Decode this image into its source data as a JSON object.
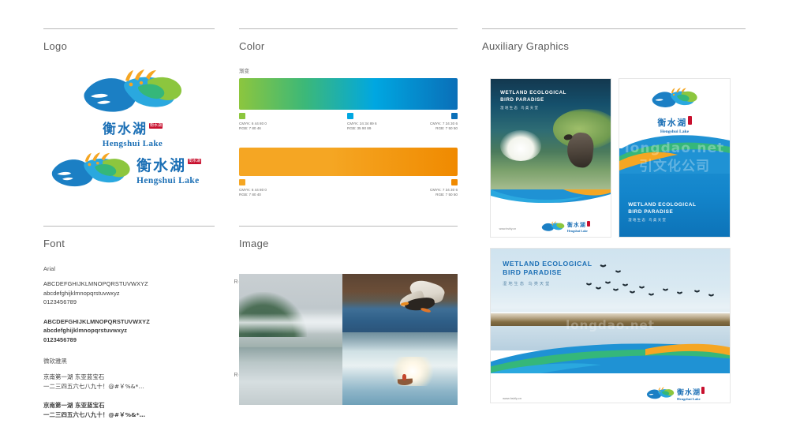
{
  "sections": {
    "logo": {
      "title": "Logo"
    },
    "color": {
      "title": "Color"
    },
    "auxiliary": {
      "title": "Auxiliary Graphics"
    },
    "font": {
      "title": "Font"
    },
    "image": {
      "title": "Image"
    }
  },
  "brand": {
    "cn_name": "衡水湖",
    "en_name": "Hengshui Lake",
    "seal": "衡水湖",
    "website": "www.hshly.cn",
    "slogan_en_line1": "WETLAND ECOLOGICAL",
    "slogan_en_line2": "BIRD PARADISE",
    "slogan_cn": "湿地生态 鸟类天堂"
  },
  "color": {
    "swatch_label": "渐变",
    "gradient_primary": {
      "stops": [
        {
          "hex": "#8CC63E",
          "cmyk": "CMYK: 6 44 80 0",
          "rgb": "RGB: 7 80 46"
        },
        {
          "hex": "#00A7E1",
          "cmyk": "CMYK: 24 34 89 6",
          "rgb": "RGB: 35 90 89"
        },
        {
          "hex": "#0A6FB8",
          "cmyk": "CMYK: 7 34 30 6",
          "rgb": "RGB: 7 50 50"
        }
      ]
    },
    "gradient_secondary": {
      "stops": [
        {
          "hex": "#F5A623",
          "cmyk": "CMYK: 6 44 80 0",
          "rgb": "RGB: 7 80 40"
        },
        {
          "hex": "#F08A00",
          "cmyk": "CMYK: 7 34 30 6",
          "rgb": "RGB: 7 50 50"
        }
      ]
    }
  },
  "fonts": [
    {
      "family": "Arial",
      "specimens": [
        {
          "weight_label": "Regular",
          "lines": [
            "ABCDEFGHIJKLMNOPQRSTUVWXYZ",
            "abcdefghijklmnopqrstuvwxyz",
            "0123456789"
          ]
        },
        {
          "weight_label": "Bold",
          "lines": [
            "ABCDEFGHIJKLMNOPQRSTUVWXYZ",
            "abcdefghijklmnopqrstuvwxyz",
            "0123456789"
          ]
        }
      ]
    },
    {
      "family": "微软雅黑",
      "specimens": [
        {
          "weight_label": "Regular",
          "lines": [
            "京南第一湖  东亚蓝宝石",
            "一二三四五六七八九十！@#￥%&*…"
          ]
        },
        {
          "weight_label": "Bold",
          "lines": [
            "京南第一湖  东亚蓝宝石",
            "一二三四五六七八九十！@#￥%&*…"
          ]
        }
      ]
    }
  ],
  "image_gallery": [
    {
      "name": "misty-lake-landscape"
    },
    {
      "name": "duck-in-flight"
    },
    {
      "name": "boat-at-sunrise"
    },
    {
      "name": "flock-over-water"
    }
  ],
  "posters": [
    {
      "name": "poster-bird-photo"
    },
    {
      "name": "poster-logo-blue"
    },
    {
      "name": "poster-flying-flock"
    }
  ],
  "watermark": {
    "line1": "longdao.net",
    "line2": "引文化公司"
  }
}
